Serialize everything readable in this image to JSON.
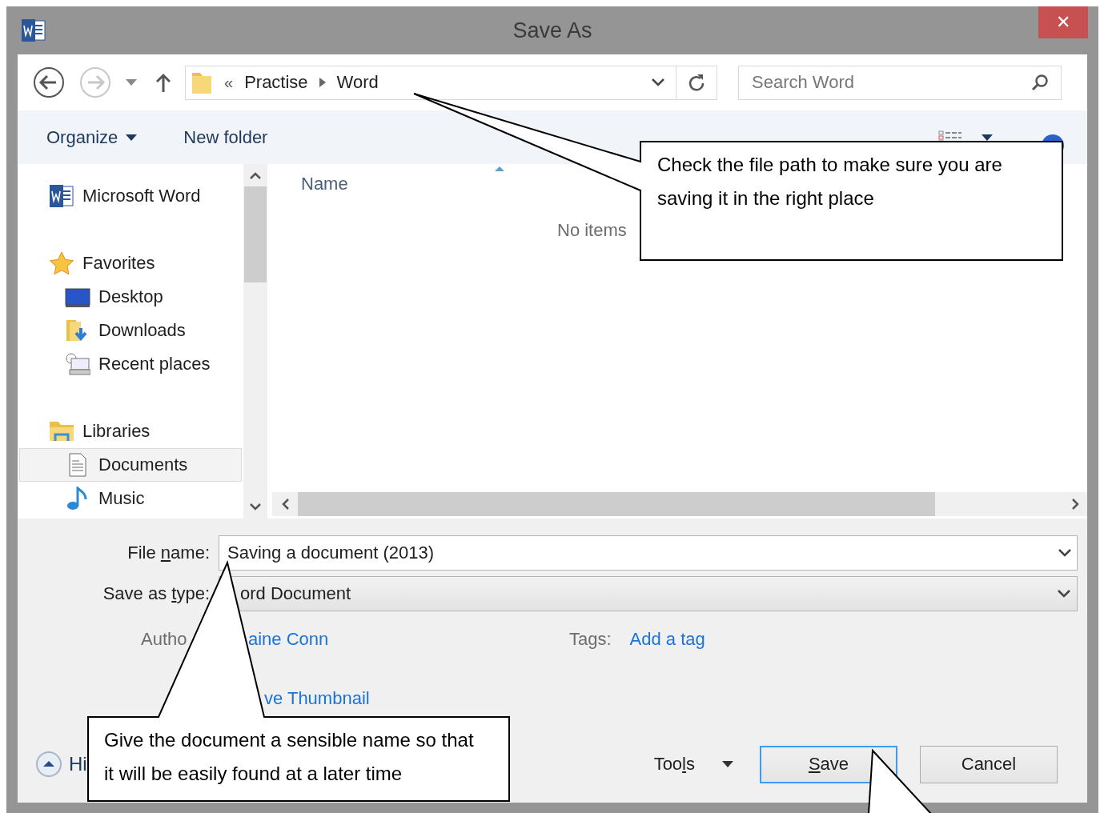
{
  "window": {
    "title": "Save As",
    "close": "✕"
  },
  "nav": {
    "back_disabled": false,
    "forward_disabled": true,
    "breadcrumb_overflow": "«",
    "path": [
      "Practise",
      "Word"
    ],
    "search": {
      "placeholder": "Search Word"
    }
  },
  "toolbar": {
    "organize": "Organize",
    "new_folder": "New folder"
  },
  "sidebar": {
    "items": [
      {
        "label": "Microsoft Word",
        "selected": false
      },
      {
        "label": "Favorites",
        "selected": false,
        "children": [
          {
            "label": "Desktop",
            "selected": false
          },
          {
            "label": "Downloads",
            "selected": false
          },
          {
            "label": "Recent places",
            "selected": false
          }
        ]
      },
      {
        "label": "Libraries",
        "selected": false,
        "children": [
          {
            "label": "Documents",
            "selected": true
          },
          {
            "label": "Music",
            "selected": false
          }
        ]
      }
    ]
  },
  "file_list": {
    "columns": [
      "Name"
    ],
    "empty_text": "No items"
  },
  "form": {
    "file_name": {
      "label": [
        {
          "text": "File "
        },
        {
          "text": "n",
          "key": true
        },
        {
          "text": "ame:"
        }
      ],
      "value": "Saving a document (2013)"
    },
    "save_type": {
      "label": [
        {
          "text": "Save as "
        },
        {
          "text": "t",
          "key": true
        },
        {
          "text": "ype:"
        }
      ],
      "value": "ord Document"
    },
    "author_label": "Autho",
    "author_value": "aine Conn",
    "tags_label": "Tags:",
    "tags_value": "Add a tag",
    "thumbnail": "ve Thumbnail"
  },
  "footer": {
    "hide_folders": "Hi",
    "tools": [
      {
        "text": "Too"
      },
      {
        "text": "l",
        "key": true
      },
      {
        "text": "s"
      }
    ],
    "buttons": [
      {
        "label": [
          {
            "text": "S",
            "key": true
          },
          {
            "text": "ave"
          }
        ],
        "kind": "default"
      },
      {
        "label": [
          {
            "text": "Cancel"
          }
        ],
        "kind": "normal"
      }
    ]
  },
  "callouts": [
    "Check the file path to make sure you are saving it in the right place",
    "Give the document a sensible name so that it will be easily found at a later time"
  ]
}
